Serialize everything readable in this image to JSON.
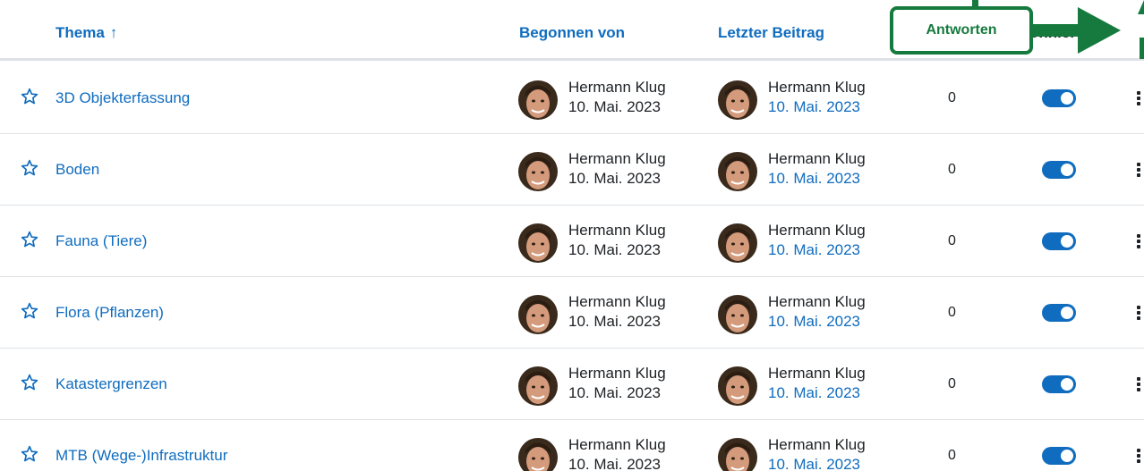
{
  "header": {
    "topic": "Thema",
    "topic_sort_arrow": "↑",
    "started_by": "Begonnen von",
    "last_post": "Letzter Beitrag",
    "subscribe_partial": "onnieren"
  },
  "annotation": {
    "label": "Antworten",
    "color": "#167a3e"
  },
  "colors": {
    "link": "#0f6cbf",
    "text": "#1d2125",
    "toggle_on": "#0f6cbf"
  },
  "rows": [
    {
      "topic": "3D Objekterfassung",
      "started_by": "Hermann Klug",
      "started_date": "10. Mai. 2023",
      "last_by": "Hermann Klug",
      "last_date": "10. Mai. 2023",
      "replies": "0",
      "subscribed": true
    },
    {
      "topic": "Boden",
      "started_by": "Hermann Klug",
      "started_date": "10. Mai. 2023",
      "last_by": "Hermann Klug",
      "last_date": "10. Mai. 2023",
      "replies": "0",
      "subscribed": true
    },
    {
      "topic": "Fauna (Tiere)",
      "started_by": "Hermann Klug",
      "started_date": "10. Mai. 2023",
      "last_by": "Hermann Klug",
      "last_date": "10. Mai. 2023",
      "replies": "0",
      "subscribed": true
    },
    {
      "topic": "Flora (Pflanzen)",
      "started_by": "Hermann Klug",
      "started_date": "10. Mai. 2023",
      "last_by": "Hermann Klug",
      "last_date": "10. Mai. 2023",
      "replies": "0",
      "subscribed": true
    },
    {
      "topic": "Katastergrenzen",
      "started_by": "Hermann Klug",
      "started_date": "10. Mai. 2023",
      "last_by": "Hermann Klug",
      "last_date": "10. Mai. 2023",
      "replies": "0",
      "subscribed": true
    },
    {
      "topic": "MTB (Wege-)Infrastruktur",
      "started_by": "Hermann Klug",
      "started_date": "10. Mai. 2023",
      "last_by": "Hermann Klug",
      "last_date": "10. Mai. 2023",
      "replies": "0",
      "subscribed": true
    }
  ]
}
